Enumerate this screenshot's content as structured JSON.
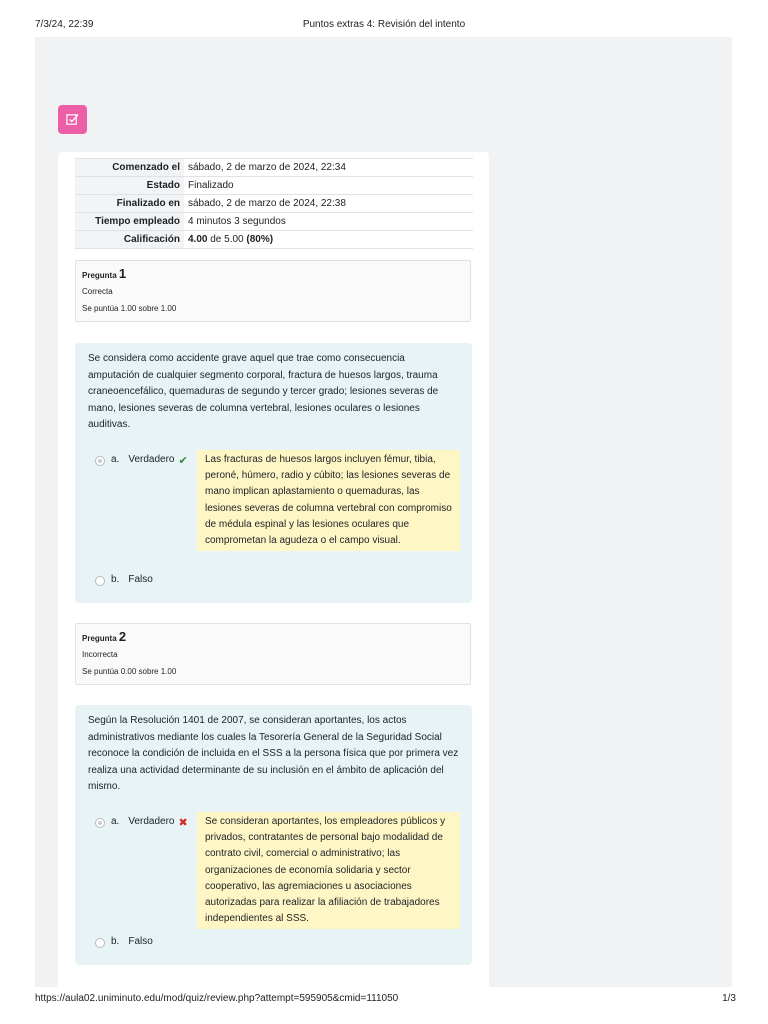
{
  "print_header": {
    "datetime": "7/3/24, 22:39",
    "title": "Puntos extras 4: Revisión del intento"
  },
  "print_footer": {
    "url": "https://aula02.uniminuto.edu/mod/quiz/review.php?attempt=595905&cmid=111050",
    "page": "1/3"
  },
  "colors": {
    "quiz_icon": "#ec5fa6",
    "question_bg": "#e7f3f5",
    "feedback_bg": "#fff6c6",
    "correct": "#2e8b3a",
    "incorrect": "#d22a2a"
  },
  "summary": {
    "rows": [
      {
        "label": "Comenzado el",
        "value": "sábado, 2 de marzo de 2024, 22:34"
      },
      {
        "label": "Estado",
        "value": "Finalizado"
      },
      {
        "label": "Finalizado en",
        "value": "sábado, 2 de marzo de 2024, 22:38"
      },
      {
        "label": "Tiempo empleado",
        "value": "4 minutos 3 segundos"
      }
    ],
    "grade_label": "Calificación",
    "grade_score": "4.00",
    "grade_of": "de 5.00",
    "grade_pct": "(80%)"
  },
  "questions": [
    {
      "label": "Pregunta",
      "number": "1",
      "state": "Correcta",
      "grade": "Se puntúa 1.00 sobre 1.00",
      "text": "Se considera como accidente grave aquel que trae como consecuencia amputación de cualquier segmento corporal, fractura de huesos largos, trauma craneoencefálico, quemaduras de segundo y tercer grado; lesiones severas de mano, lesiones severas de columna vertebral, lesiones oculares o lesiones auditivas.",
      "answers": [
        {
          "letter": "a.",
          "text": "Verdadero",
          "selected": true,
          "mark": "correct-check-icon"
        },
        {
          "letter": "b.",
          "text": "Falso",
          "selected": false
        }
      ],
      "feedback": "Las fracturas de huesos largos incluyen fémur, tibia, peroné, húmero, radio y cúbito; las lesiones severas de mano implican aplastamiento o quemaduras, las lesiones severas de columna vertebral con compromiso de médula espinal y las lesiones oculares que comprometan la agudeza o el campo visual."
    },
    {
      "label": "Pregunta",
      "number": "2",
      "state": "Incorrecta",
      "grade": "Se puntúa 0.00 sobre 1.00",
      "text": "Según la Resolución 1401 de 2007, se consideran aportantes, los actos administrativos mediante los cuales la Tesorería General de la Seguridad Social reconoce la condición de incluida en el SSS a la persona física que por primera vez realiza una actividad determinante de su inclusión en el ámbito de aplicación del mismo.",
      "answers": [
        {
          "letter": "a.",
          "text": "Verdadero",
          "selected": true,
          "mark": "incorrect-cross-icon"
        },
        {
          "letter": "b.",
          "text": "Falso",
          "selected": false
        }
      ],
      "feedback": "Se consideran aportantes, los empleadores públicos y privados, contratantes de personal bajo modalidad de contrato civil, comercial o administrativo; las organizaciones de economía solidaria y sector cooperativo, las agremiaciones u asociaciones autorizadas para realizar la afiliación de trabajadores independientes al SSS."
    }
  ]
}
